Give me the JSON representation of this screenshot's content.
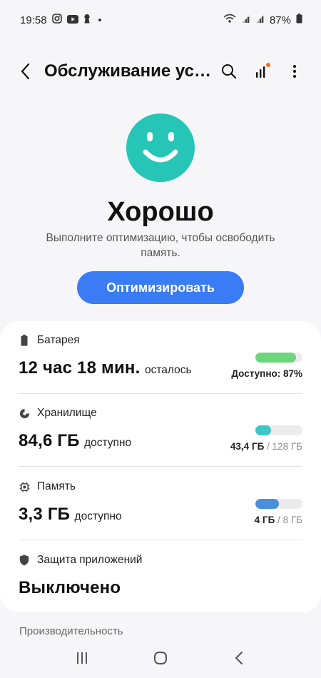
{
  "status_bar": {
    "time": "19:58",
    "battery_percent": "87%",
    "icons": [
      "instagram-icon",
      "youtube-icon",
      "keyhole-icon",
      "dot-icon",
      "wifi-call-icon",
      "signal-icon",
      "signal-icon",
      "battery-icon"
    ]
  },
  "header": {
    "title": "Обслуживание устройства",
    "icons": [
      "back-icon",
      "search-icon",
      "signal-bars-icon",
      "more-icon"
    ]
  },
  "hero": {
    "status": "Хорошо",
    "subtitle": "Выполните оптимизацию, чтобы освободить память.",
    "optimize_label": "Оптимизировать",
    "face_color": "#26c6b6"
  },
  "battery": {
    "label": "Батарея",
    "value": "12 час 18 мин.",
    "unit": "осталось",
    "meta": "Доступно: 87%",
    "fill_fraction": 0.87,
    "color": "#6cd67f"
  },
  "storage": {
    "label": "Хранилище",
    "value": "84,6 ГБ",
    "unit": "доступно",
    "used": "43,4 ГБ",
    "total": "/ 128 ГБ",
    "fill_fraction": 0.34,
    "color": "#3fc6c6"
  },
  "memory": {
    "label": "Память",
    "value": "3,3 ГБ",
    "unit": "доступно",
    "used": "4 ГБ",
    "total": "/ 8 ГБ",
    "fill_fraction": 0.5,
    "color": "#4a8fdc"
  },
  "app_protection": {
    "label": "Защита приложений",
    "value": "Выключено"
  },
  "performance": {
    "label": "Производительность"
  },
  "nav": {
    "icons": [
      "recents-icon",
      "home-icon",
      "back-nav-icon"
    ]
  }
}
